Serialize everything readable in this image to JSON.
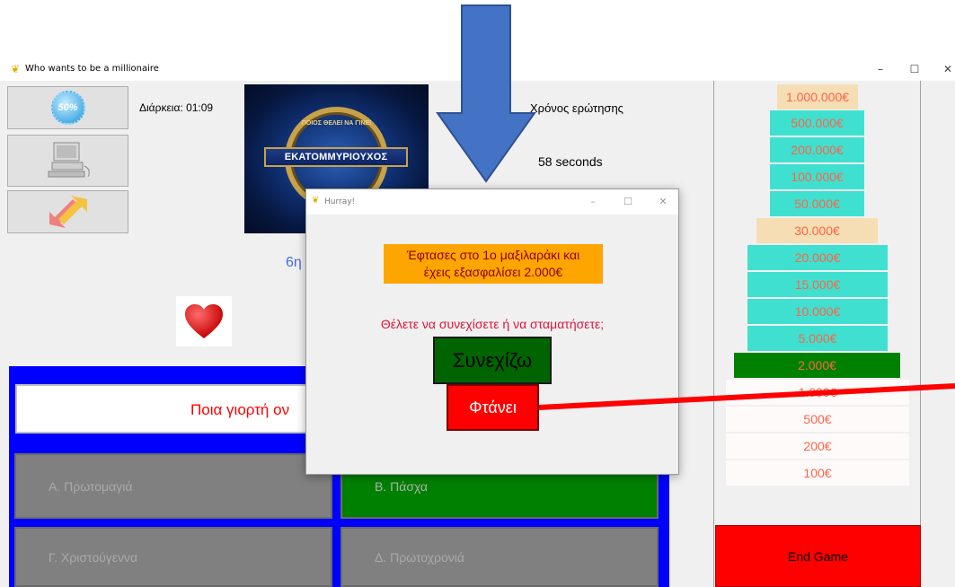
{
  "window": {
    "title": "Who wants to be a millionaire",
    "controls": {
      "minimize": "–",
      "maximize": "☐",
      "close": "✕"
    }
  },
  "lifelines": {
    "fifty_fifty_label": "50%"
  },
  "game": {
    "duration": "Διάρκεια: 01:09",
    "question_time_label": "Χρόνος ερώτησης",
    "question_time_value": "58 seconds",
    "question_number": "6η",
    "question_text": "Ποια γιορτή ον",
    "answers": {
      "a": "Α. Πρωτομαγιά",
      "b": "Β. Πάσχα",
      "c": "Γ. Χριστούγεννα",
      "d": "Δ. Πρωτοχρονιά"
    },
    "end_game_label": "End Game"
  },
  "logo": {
    "top_text": "ΠΟΙΟΣ ΘΕΛΕΙ ΝΑ ΓΙΝΕΙ",
    "band_text": "ΕΚΑΤΟΜΜΥΡΙΟΥΧΟΣ"
  },
  "prize_ladder": [
    {
      "label": "1.000.000€",
      "bg": "#f5deb3",
      "fg": "#ff6347"
    },
    {
      "label": "500.000€",
      "bg": "#40e0d0",
      "fg": "#ff6347"
    },
    {
      "label": "200.000€",
      "bg": "#40e0d0",
      "fg": "#ff6347"
    },
    {
      "label": "100.000€",
      "bg": "#40e0d0",
      "fg": "#ff6347"
    },
    {
      "label": "50.000€",
      "bg": "#40e0d0",
      "fg": "#ff6347"
    },
    {
      "label": "30.000€",
      "bg": "#f5deb3",
      "fg": "#ff6347"
    },
    {
      "label": "20.000€",
      "bg": "#40e0d0",
      "fg": "#ff6347"
    },
    {
      "label": "15.000€",
      "bg": "#40e0d0",
      "fg": "#ff6347"
    },
    {
      "label": "10.000€",
      "bg": "#40e0d0",
      "fg": "#ff6347"
    },
    {
      "label": "5.000€",
      "bg": "#40e0d0",
      "fg": "#ff6347"
    },
    {
      "label": "2.000€",
      "bg": "#008000",
      "fg": "#ff6347"
    },
    {
      "label": "1.000€",
      "bg": "#fffafa",
      "fg": "#ff6347"
    },
    {
      "label": "500€",
      "bg": "#fffafa",
      "fg": "#ff6347"
    },
    {
      "label": "200€",
      "bg": "#fffafa",
      "fg": "#ff6347"
    },
    {
      "label": "100€",
      "bg": "#fffafa",
      "fg": "#ff6347"
    }
  ],
  "dialog": {
    "title": "Hurray!",
    "cushion_line1": "Έφτασες στο 1ο μαξιλαράκι και",
    "cushion_line2": "έχεις εξασφαλίσει 2.000€",
    "prompt": "Θέλετε να συνεχίσετε ή να σταματήσετε;",
    "continue_label": "Συνεχίζω",
    "stop_label": "Φτάνει"
  },
  "colors": {
    "annotation_arrow": "#4472c4",
    "annotation_line": "#ff0000"
  }
}
